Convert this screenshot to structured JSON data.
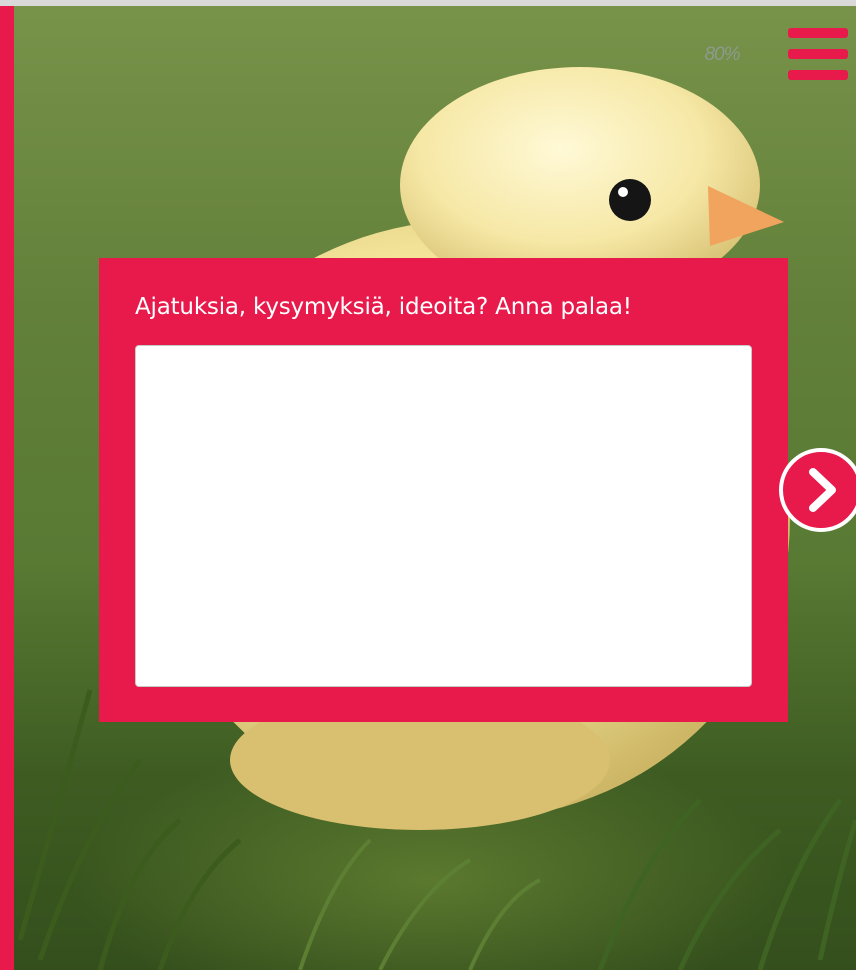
{
  "progress": {
    "label": "80%",
    "value": 0.8
  },
  "feedback": {
    "title": "Ajatuksia, kysymyksiä, ideoita? Anna palaa!",
    "answer_value": "",
    "placeholder": ""
  },
  "icons": {
    "menu": "hamburger-icon",
    "next": "chevron-right-icon"
  },
  "colors": {
    "accent": "#e8194b",
    "panel_text": "#ffffff",
    "progress_text": "#8e9a8c",
    "field_background": "#ffffff"
  },
  "background_image": "yellow chick in green grass"
}
